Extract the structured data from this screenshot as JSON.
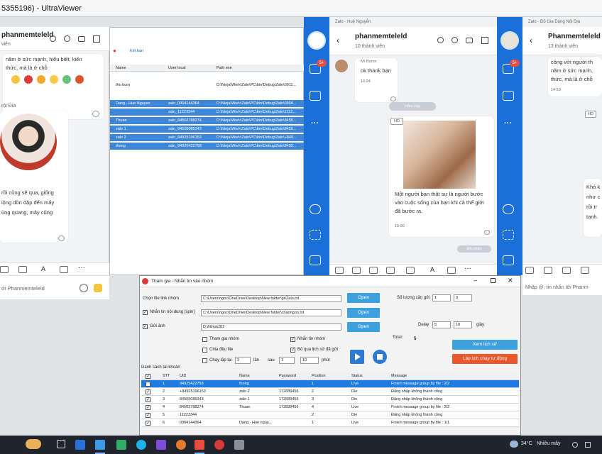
{
  "window": {
    "title": "5355196) - UltraViewer"
  },
  "zalo_left": {
    "name": "phanmemteleld",
    "subtitle": "viên",
    "msg1": "năm ở sức mạnh, hiểu biết, kiến",
    "msg1b": "thức, mà là ở chỗ",
    "sender": "rội Đia",
    "msg2a": "rồi cũng sẽ qua, giống",
    "msg2b": "iộng dồn dập đến mấy",
    "msg2c": "ùng quang, mây cũng",
    "composer_placeholder": "ới Phanmemteleld"
  },
  "tool": {
    "tab_label": "Kết bạn",
    "columns": [
      "Name",
      "User local",
      "Path exe"
    ],
    "rows": [
      {
        "name": "tho bum",
        "user": "",
        "path": "D:\\Ninja\\Work\\Zalo\\PC\\bin\\Debug\\Zalo\\0911..."
      },
      {
        "name": "Dang - Hue Nguyen",
        "user": "zalo_0904144364",
        "path": "D:\\Ninja\\Work\\Zalo\\PC\\bin\\Debug\\Zalo\\0904..."
      },
      {
        "name": "",
        "user": "zalo_11223344",
        "path": "D:\\Ninja\\Work\\Zalo\\PC\\bin\\Debug\\Zalo\\1122..."
      },
      {
        "name": "Thuan",
        "user": "zalo_84502788274",
        "path": "D:\\Ninja\\Work\\Zalo\\PC\\bin\\Debug\\Zalo\\8450..."
      },
      {
        "name": "zalo 1",
        "user": "zalo_84505085343",
        "path": "D:\\Ninja\\Work\\Zalo\\PC\\bin\\Debug\\Zalo\\8450..."
      },
      {
        "name": "zalo 2",
        "user": "zalo_84925196153",
        "path": "D:\\Ninja\\Work\\Zalo\\PC\\bin\\Debug\\Zalo\\+849..."
      },
      {
        "name": "thong",
        "user": "zalo_84925422758",
        "path": "D:\\Ninja\\Work\\Zalo\\PC\\bin\\Debug\\Zalo\\8492..."
      }
    ]
  },
  "zalo_mid": {
    "window_label": "Zalo - Huệ Nguyễn",
    "name": "phanmemteleld",
    "members": "10 thành viên",
    "sender_small": "Mr Buron",
    "msg": "ok thank bạn",
    "time1": "16:24",
    "day_sep": "Hôm nay",
    "hd": "HD",
    "caption": "Một người bạn thật sự là người bước vào cuộc sống của bạn khi cả thế giới đã bước ra.",
    "time2": "15:00",
    "reply_hint": "Đã nhận",
    "badge": "5+"
  },
  "zalo_right": {
    "window_label": "Zalo - Đồ Gia Dụng Nội Địa",
    "name": "Phanmemteleld",
    "members": "13 thành viên",
    "msg_a": "công với người th",
    "msg_b": "năm ở sức mạnh,",
    "msg_c": "thức, mà là ở chỗ",
    "time": "14:59",
    "hd": "HD",
    "side_a": "Khó k",
    "side_b": "như c",
    "side_c": "rồi tr",
    "side_d": "tanh.",
    "composer_placeholder": "Nhập @, tin nhắn tới Phanm",
    "badge": "5+"
  },
  "dialog": {
    "title": "Tham gia - Nhắn tin vào nhóm",
    "link_label": "Chọn file link nhóm",
    "link_path": "C:\\Users\\ngoc\\OneDrive\\Desktop\\New folder\\gr\\Zalo.txt",
    "send_label": "Nhắn tin nội dung [spin]",
    "send_path": "C:\\Users\\ngoc\\OneDrive\\Desktop\\New folder\\chaongon.txt",
    "img_label": "Gửi ảnh",
    "img_path": "D:\\Ninja\\202",
    "open": "Open",
    "group_count_label": "Số lượng cần gửi",
    "group_from": "1",
    "group_to": "3",
    "delay_label": "Delay",
    "delay_from": "5",
    "delay_to": "10",
    "delay_unit": "giây",
    "total_label": "Total:",
    "total_value": "5",
    "opt_join": "Tham gia nhóm",
    "opt_msg": "Nhắn tin nhóm",
    "opt_file": "Chia đều file",
    "opt_skip": "Bỏ qua lịch sử đã gửi",
    "opt_loop": "Chạy lặp lại",
    "loop_n": "3",
    "loop_times": "lần",
    "after": "sau",
    "after_from": "1",
    "after_to": "10",
    "after_unit": "phút",
    "btn_history": "Xem lịch sử",
    "btn_schedule": "Lập lịch chạy tự động",
    "list_label": "Danh sách tài khoản",
    "cols": [
      "STT",
      "UID",
      "Name",
      "Password",
      "Position",
      "Status",
      "Message"
    ],
    "rows": [
      {
        "stt": "1",
        "uid": "84925422758",
        "name": "thong",
        "pw": "",
        "pos": "1",
        "status": "Live",
        "msg": "Finish message group by file : 2/2"
      },
      {
        "stt": "2",
        "uid": "+84925196153",
        "name": "zalo 2",
        "pw": "172839456",
        "pos": "2",
        "status": "Die",
        "msg": "Đăng nhập không thành công"
      },
      {
        "stt": "3",
        "uid": "84505085343",
        "name": "zalo 1",
        "pw": "172839456",
        "pos": "3",
        "status": "Die",
        "msg": "Đăng nhập không thành công"
      },
      {
        "stt": "4",
        "uid": "84502788274",
        "name": "Thuan",
        "pw": "172839456",
        "pos": "4",
        "status": "Live",
        "msg": "Finish message group by file : 2/2"
      },
      {
        "stt": "5",
        "uid": "11223344",
        "name": "",
        "pw": "",
        "pos": "2",
        "status": "Die",
        "msg": "Đăng nhập không thành công"
      },
      {
        "stt": "6",
        "uid": "0904144364",
        "name": "Dang - Hue nguy...",
        "pw": "",
        "pos": "1",
        "status": "Live",
        "msg": "Finish message group by file : 1/1"
      }
    ]
  },
  "taskbar": {
    "temp": "34°C",
    "weather": "Nhiều mây",
    "colors": {
      "bar": "#20242c",
      "accent": "#1b6fd8"
    }
  }
}
